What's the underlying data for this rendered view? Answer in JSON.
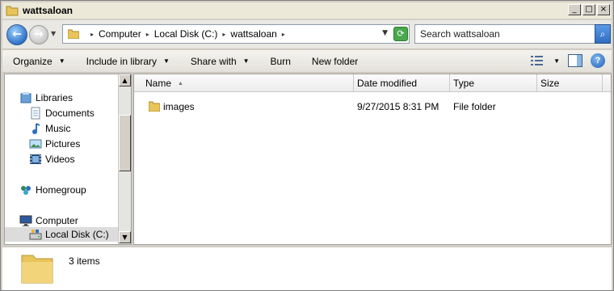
{
  "window": {
    "title": "wattsaloan"
  },
  "window_controls": {
    "minimize": "_",
    "maximize": "□",
    "close": "×"
  },
  "address": {
    "crumbs": [
      "Computer",
      "Local Disk (C:)",
      "wattsaloan"
    ]
  },
  "search": {
    "placeholder": "Search wattsaloan"
  },
  "toolbar": {
    "organize": "Organize",
    "include_in_library": "Include in library",
    "share_with": "Share with",
    "burn": "Burn",
    "new_folder": "New folder"
  },
  "nav": {
    "libraries": "Libraries",
    "documents": "Documents",
    "music": "Music",
    "pictures": "Pictures",
    "videos": "Videos",
    "homegroup": "Homegroup",
    "computer": "Computer",
    "local_disk": "Local Disk (C:)"
  },
  "columns": {
    "name": "Name",
    "date_modified": "Date modified",
    "type": "Type",
    "size": "Size"
  },
  "files": [
    {
      "name": "images",
      "date_modified": "9/27/2015 8:31 PM",
      "type": "File folder",
      "size": ""
    }
  ],
  "details": {
    "item_count": "3 items"
  },
  "colors": {
    "folder": "#e8c45a",
    "selection": "#dcdcdc",
    "accent": "#2f6dc2"
  }
}
